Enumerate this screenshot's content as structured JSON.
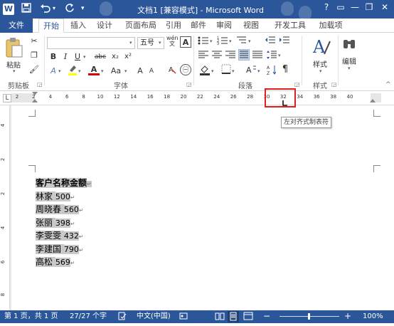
{
  "titlebar": {
    "title": "文档1 [兼容模式] - Microsoft Word",
    "word_logo": "W",
    "qat": {
      "save_icon": "save-icon",
      "undo_icon": "undo-icon",
      "redo_icon": "redo-icon",
      "customize_icon": "chevron-down-icon"
    },
    "window_buttons": [
      "?",
      "▭",
      "—",
      "❐",
      "✕"
    ]
  },
  "tabs": {
    "file": "文件",
    "items": [
      "开始",
      "插入",
      "设计",
      "页面布局",
      "引用",
      "邮件",
      "审阅",
      "视图",
      "开发工具",
      "加载项"
    ],
    "active": "开始"
  },
  "ribbon": {
    "clipboard": {
      "paste": "粘贴",
      "label": "剪贴板"
    },
    "font": {
      "font_name": "",
      "font_size": "五号",
      "label": "字体",
      "row2": [
        "B",
        "I",
        "U",
        "abc",
        "x₂",
        "x²"
      ],
      "row3": [
        "A",
        "A",
        "Aa",
        "A",
        "A",
        "㊀"
      ]
    },
    "paragraph": {
      "label": "段落"
    },
    "styles": {
      "button": "样式",
      "label": "样式"
    },
    "editing": {
      "button": "编辑"
    }
  },
  "ruler": {
    "tab_selector": "L",
    "numbers": [
      "2",
      "2",
      "4",
      "6",
      "8",
      "10",
      "12",
      "14",
      "16",
      "18",
      "20",
      "22",
      "24",
      "26",
      "28",
      "30",
      "32",
      "34",
      "36",
      "38",
      "40"
    ],
    "vertical_numbers": [
      "4",
      "2",
      "2",
      "4",
      "6",
      "8"
    ],
    "tooltip": "左对齐式制表符"
  },
  "document": {
    "lines": [
      {
        "text": "客户名称金额",
        "bold": true
      },
      {
        "text": "林家 ",
        "num": "500"
      },
      {
        "text": "周晓春 ",
        "num": "560"
      },
      {
        "text": "张丽 ",
        "num": "398"
      },
      {
        "text": "李雯雯 ",
        "num": "432"
      },
      {
        "text": "李建国 ",
        "num": "790"
      },
      {
        "text": "高松 ",
        "num": "569"
      }
    ],
    "paragraph_mark": "↵"
  },
  "statusbar": {
    "page": "第 1 页，共 1 页",
    "words": "27/27 个字",
    "language": "中文(中国)",
    "zoom": "100%",
    "zoom_minus": "−",
    "zoom_plus": "+"
  },
  "colors": {
    "brand": "#2b579a",
    "highlight": "#e02020",
    "selection": "#c9c9c9"
  }
}
